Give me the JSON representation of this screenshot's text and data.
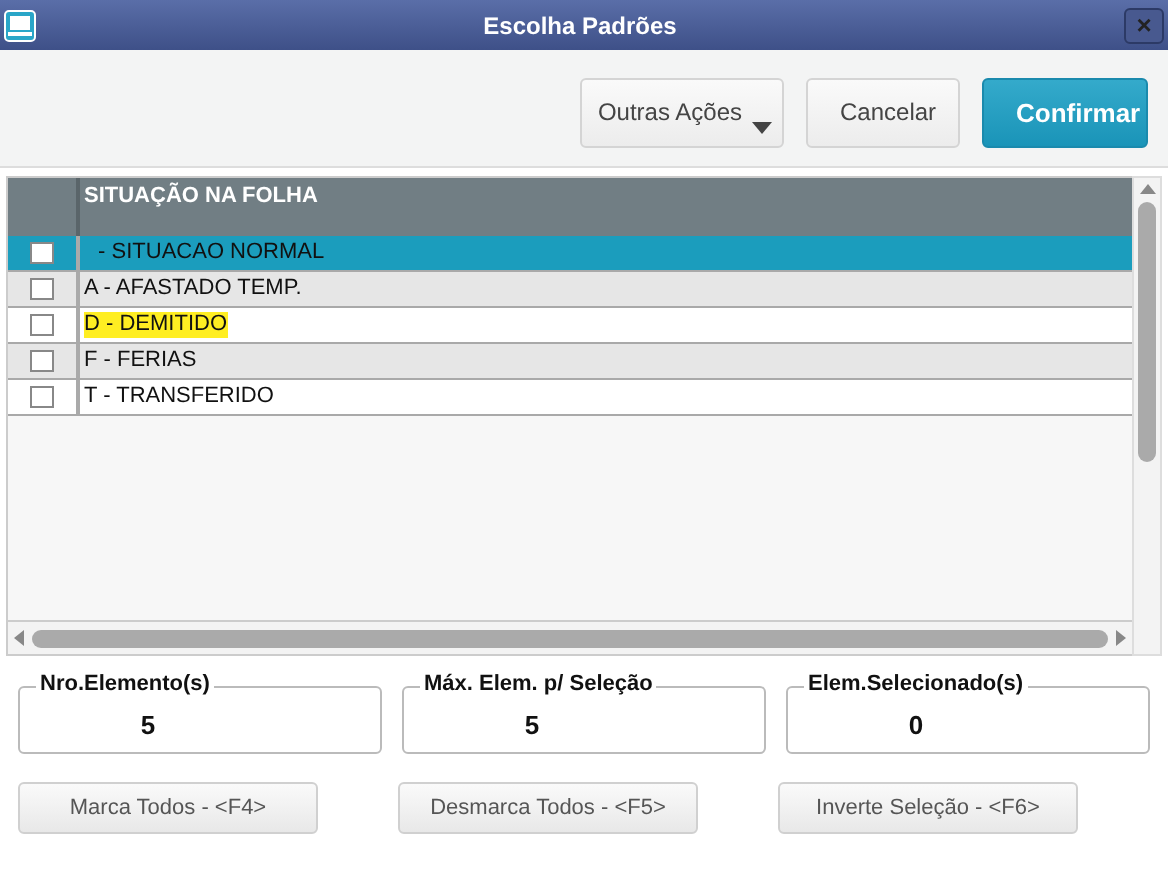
{
  "window": {
    "title": "Escolha Padrões",
    "close": "×"
  },
  "toolbar": {
    "buttons": [
      {
        "label": "Outras Ações",
        "kind": "menu"
      },
      {
        "label": "Cancelar",
        "kind": "plain"
      },
      {
        "label": "Confirmar",
        "kind": "primary"
      }
    ]
  },
  "table": {
    "columns": [
      "SITUAÇÃO NA FOLHA"
    ],
    "rows": [
      {
        "text": " - SITUACAO NORMAL",
        "checked": false,
        "selected": true,
        "highlighted": false
      },
      {
        "text": "A - AFASTADO TEMP.",
        "checked": false,
        "selected": false,
        "highlighted": false
      },
      {
        "text": "D - DEMITIDO",
        "checked": false,
        "selected": false,
        "highlighted": true
      },
      {
        "text": "F - FERIAS",
        "checked": false,
        "selected": false,
        "highlighted": false
      },
      {
        "text": "T - TRANSFERIDO",
        "checked": false,
        "selected": false,
        "highlighted": false
      }
    ]
  },
  "counters": [
    {
      "label": "Nro.Elemento(s)",
      "value": "5"
    },
    {
      "label": "Máx. Elem. p/ Seleção",
      "value": "5"
    },
    {
      "label": "Elem.Selecionado(s)",
      "value": "0"
    }
  ],
  "buttons": [
    "Marca Todos - <F4>",
    "Desmarca Todos - <F5>",
    "Inverte Seleção - <F6>"
  ]
}
